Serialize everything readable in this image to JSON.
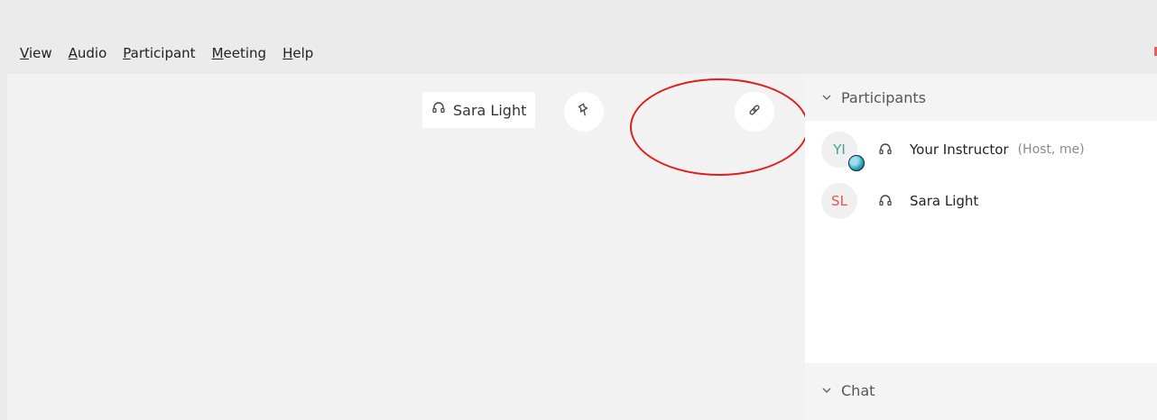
{
  "menu": {
    "items": [
      {
        "mnemonic": "V",
        "rest": "iew"
      },
      {
        "mnemonic": "A",
        "rest": "udio"
      },
      {
        "mnemonic": "P",
        "rest": "articipant"
      },
      {
        "mnemonic": "M",
        "rest": "eeting"
      },
      {
        "mnemonic": "H",
        "rest": "elp"
      }
    ]
  },
  "stage": {
    "active_speaker_name": "Sara Light",
    "icons": {
      "headset": "headset-icon",
      "pin": "pin-icon",
      "link": "link-icon"
    }
  },
  "panel": {
    "participants_title": "Participants",
    "chat_title": "Chat",
    "participants": [
      {
        "initials": "YI",
        "name": "Your Instructor",
        "role": "(Host, me)"
      },
      {
        "initials": "SL",
        "name": "Sara Light",
        "role": ""
      }
    ]
  },
  "colors": {
    "highlight_circle": "#e11d1d",
    "avatar_yi": "#3fa39a",
    "avatar_sl": "#e35555"
  }
}
